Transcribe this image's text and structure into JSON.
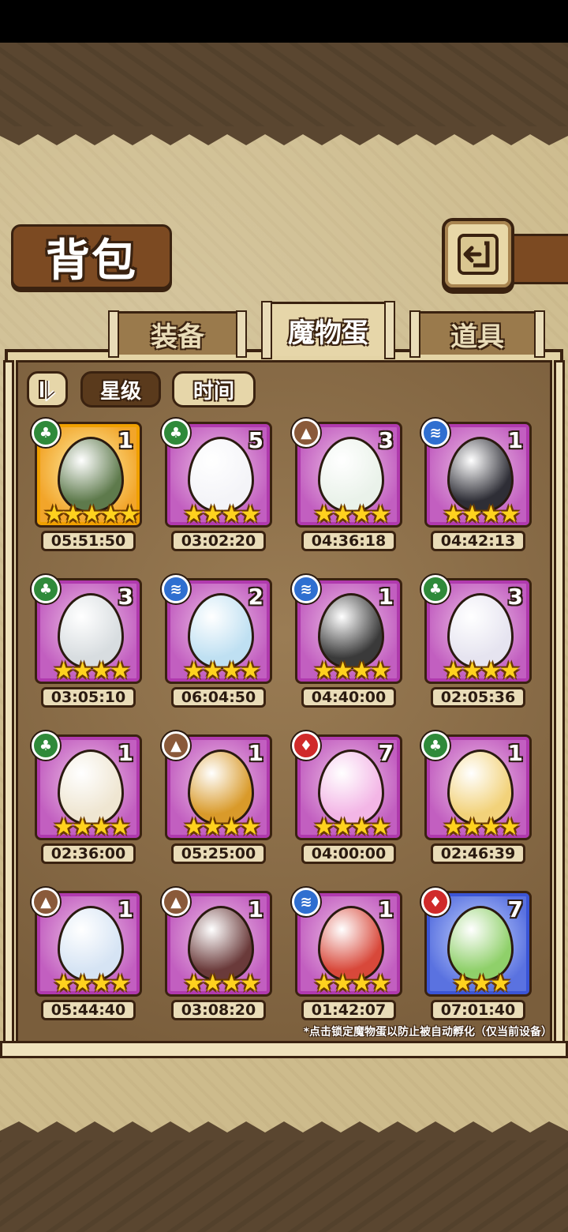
{
  "header": {
    "title": "背包",
    "back_icon": "return-arrow-icon"
  },
  "tabs": [
    {
      "label": "装备",
      "active": false
    },
    {
      "label": "魔物蛋",
      "active": true
    },
    {
      "label": "道具",
      "active": false
    }
  ],
  "filters": {
    "sort_toggle_icon": "sort-toggle-icon",
    "star_label": "星级",
    "time_label": "时间",
    "active": "星级"
  },
  "elements": {
    "grass": {
      "color": "#2f8a3a",
      "icon": "leaf-icon"
    },
    "earth": {
      "color": "#8a5a3a",
      "icon": "mountain-icon"
    },
    "water": {
      "color": "#2f6fd0",
      "icon": "wave-icon"
    },
    "fire": {
      "color": "#d02a2a",
      "icon": "flame-icon"
    }
  },
  "eggs": [
    {
      "element": "grass",
      "count": "1",
      "stars": 5,
      "time": "05:51:50",
      "frame": "gold",
      "egg_color": "#5e7a4c"
    },
    {
      "element": "grass",
      "count": "5",
      "stars": 4,
      "time": "03:02:20",
      "frame": "purple",
      "egg_color": "#f4f4f8"
    },
    {
      "element": "earth",
      "count": "3",
      "stars": 4,
      "time": "04:36:18",
      "frame": "purple",
      "egg_color": "#eaf2ea"
    },
    {
      "element": "water",
      "count": "1",
      "stars": 4,
      "time": "04:42:13",
      "frame": "purple",
      "egg_color": "#2e2e36"
    },
    {
      "element": "grass",
      "count": "3",
      "stars": 4,
      "time": "03:05:10",
      "frame": "purple",
      "egg_color": "#d8dde0"
    },
    {
      "element": "water",
      "count": "2",
      "stars": 4,
      "time": "06:04:50",
      "frame": "purple",
      "egg_color": "#bfe0f2"
    },
    {
      "element": "water",
      "count": "1",
      "stars": 4,
      "time": "04:40:00",
      "frame": "purple",
      "egg_color": "#3a3a3a"
    },
    {
      "element": "grass",
      "count": "3",
      "stars": 4,
      "time": "02:05:36",
      "frame": "purple",
      "egg_color": "#e6e4f0"
    },
    {
      "element": "grass",
      "count": "1",
      "stars": 4,
      "time": "02:36:00",
      "frame": "purple",
      "egg_color": "#efe6d2"
    },
    {
      "element": "earth",
      "count": "1",
      "stars": 4,
      "time": "05:25:00",
      "frame": "purple",
      "egg_color": "#d99a2a"
    },
    {
      "element": "fire",
      "count": "7",
      "stars": 4,
      "time": "04:00:00",
      "frame": "purple",
      "egg_color": "#f3b6e6"
    },
    {
      "element": "grass",
      "count": "1",
      "stars": 4,
      "time": "02:46:39",
      "frame": "purple",
      "egg_color": "#f2d27a"
    },
    {
      "element": "earth",
      "count": "1",
      "stars": 4,
      "time": "05:44:40",
      "frame": "purple",
      "egg_color": "#d6e4f4"
    },
    {
      "element": "earth",
      "count": "1",
      "stars": 4,
      "time": "03:08:20",
      "frame": "purple",
      "egg_color": "#6a3a3a"
    },
    {
      "element": "water",
      "count": "1",
      "stars": 4,
      "time": "01:42:07",
      "frame": "purple",
      "egg_color": "#d8483a"
    },
    {
      "element": "fire",
      "count": "7",
      "stars": 3,
      "time": "07:01:40",
      "frame": "blue",
      "egg_color": "#8fd06a"
    }
  ],
  "footer_note": "*点击锁定魔物蛋以防止被自动孵化（仅当前设备）"
}
